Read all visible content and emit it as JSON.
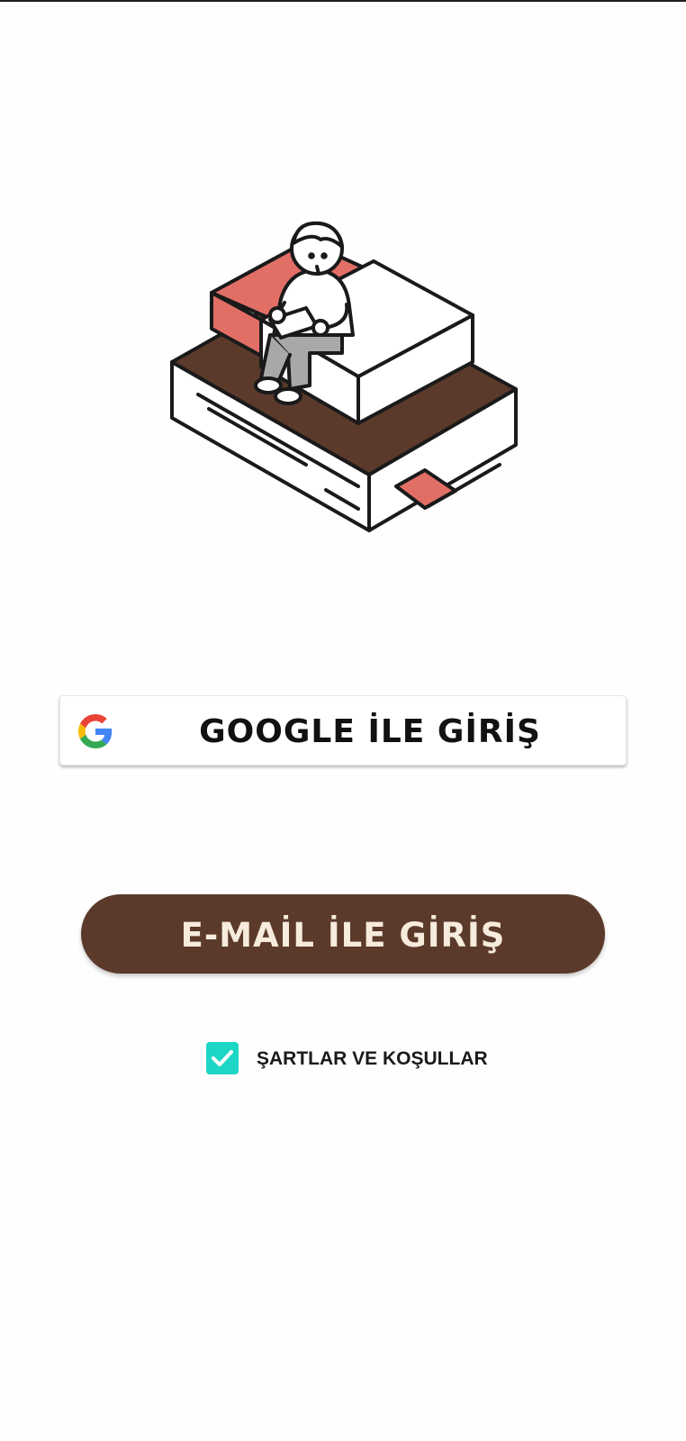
{
  "login": {
    "google_button_label": "GOOGLE İLE GİRİŞ",
    "email_button_label": "E-MAİL İLE GİRİŞ",
    "terms_label": "ŞARTLAR VE KOŞULLAR",
    "terms_checked": true
  },
  "icons": {
    "google": "google-g-logo",
    "checkbox": "checkmark-icon",
    "illustration": "person-sitting-on-book-illustration"
  },
  "colors": {
    "background": "#fefefe",
    "email_button": "#5b3a2b",
    "email_button_text": "#f6ebdc",
    "checkbox": "#1ed6c5",
    "illustration_red": "#e26f66",
    "illustration_brown": "#5b3a2b"
  }
}
